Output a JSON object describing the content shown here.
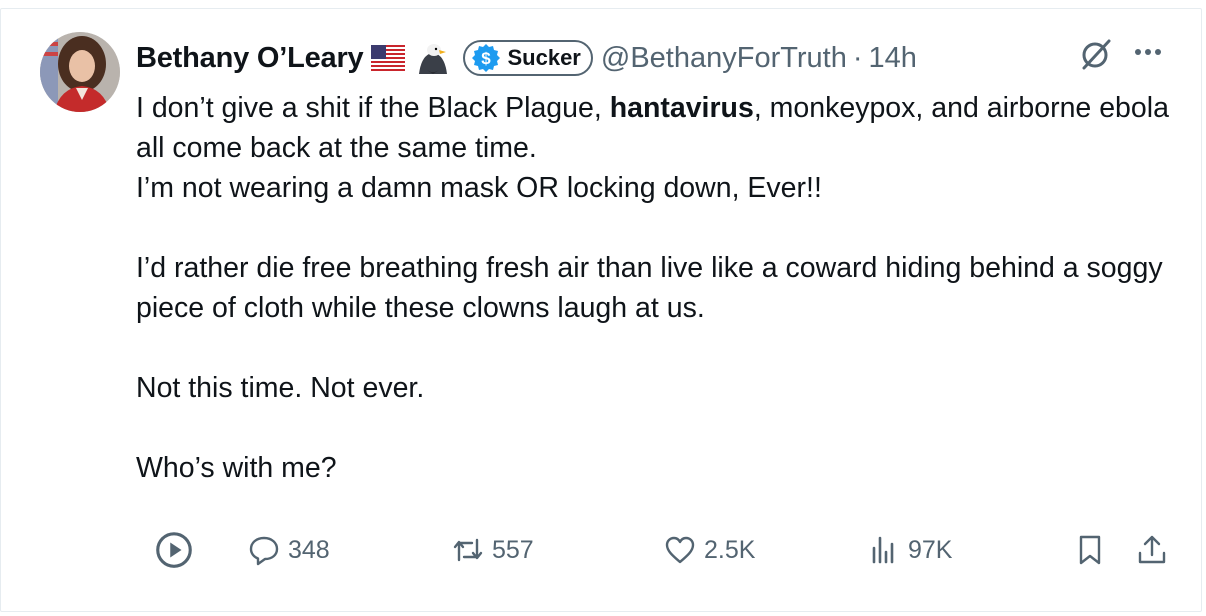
{
  "post": {
    "author_name": "Bethany O’Leary",
    "badge_label": "Sucker",
    "handle": "@BethanyForTruth",
    "separator": "·",
    "time": "14h",
    "lines": [
      {
        "pre": "I don’t give a shit if the Black Plague, ",
        "bold": "hantavirus",
        "post": ", monkeypox, and airborne ebola all come back at the same time."
      },
      {
        "text": "I’m not wearing a damn mask OR locking down, Ever!!"
      },
      {
        "text": "I’d rather die free breathing fresh air than live like a coward hiding behind a soggy piece of cloth while these clowns laugh at us."
      },
      {
        "text": "Not this time. Not ever."
      },
      {
        "text": "Who’s with me?"
      }
    ]
  },
  "actions": {
    "replies": "348",
    "reposts": "557",
    "likes": "2.5K",
    "views": "97K"
  },
  "colors": {
    "text": "#0f1419",
    "secondary": "#536471",
    "badge_blue": "#1d9bf0"
  },
  "icons": [
    "flag-us-icon",
    "eagle-icon",
    "dollar-badge-icon",
    "grok-icon",
    "more-icon",
    "play-icon",
    "reply-icon",
    "repost-icon",
    "like-icon",
    "views-icon",
    "bookmark-icon",
    "share-icon"
  ]
}
